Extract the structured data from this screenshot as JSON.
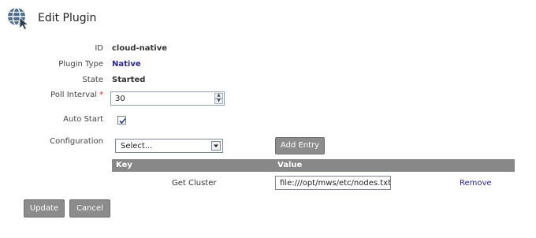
{
  "header": {
    "title": "Edit Plugin",
    "icon": "globe-cursor-icon"
  },
  "form": {
    "id_label": "ID",
    "id_value": "cloud-native",
    "type_label": "Plugin Type",
    "type_value": "Native",
    "state_label": "State",
    "state_value": "Started",
    "poll_label": "Poll Interval",
    "poll_required": "*",
    "poll_value": "30",
    "autostart_label": "Auto Start",
    "autostart_checked": true,
    "config_label": "Configuration",
    "config_select": "Select...",
    "add_entry": "Add Entry"
  },
  "table": {
    "headers": {
      "key": "Key",
      "value": "Value"
    },
    "rows": [
      {
        "key": "Get Cluster",
        "value": "file:///opt/mws/etc/nodes.txt",
        "action": "Remove"
      }
    ]
  },
  "actions": {
    "update": "Update",
    "cancel": "Cancel"
  },
  "colors": {
    "link": "#2525a0",
    "button": "#8c8c8c",
    "table_header": "#888888",
    "required": "#cc2222"
  }
}
